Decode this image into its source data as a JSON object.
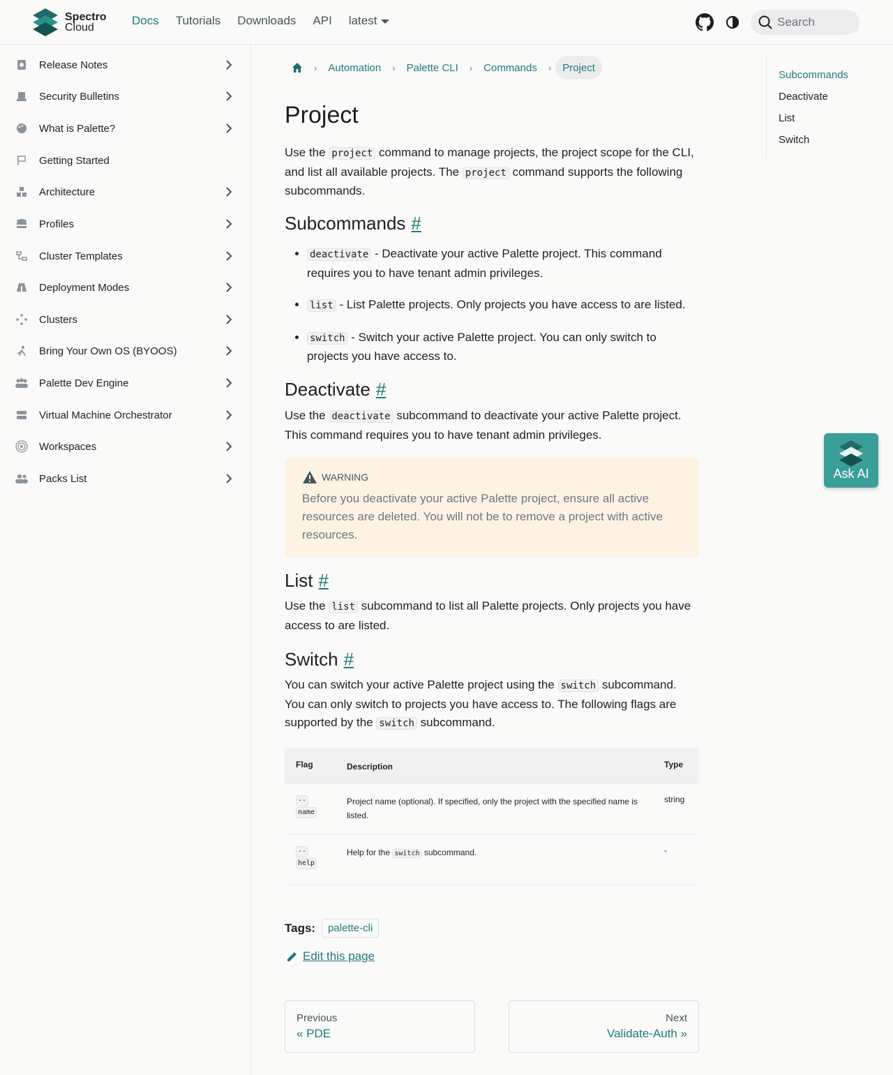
{
  "header": {
    "logo": {
      "line1": "Spectro",
      "line2": "Cloud"
    },
    "nav": [
      {
        "label": "Docs",
        "active": true
      },
      {
        "label": "Tutorials"
      },
      {
        "label": "Downloads"
      },
      {
        "label": "API"
      },
      {
        "label": "latest"
      }
    ],
    "search_placeholder": "Search",
    "icons": [
      "github-icon",
      "theme-toggle-icon",
      "search-icon"
    ]
  },
  "sidebar": {
    "items": [
      {
        "label": "Release Notes",
        "icon": "release-notes-icon",
        "has_children": true
      },
      {
        "label": "Security Bulletins",
        "icon": "security-icon",
        "has_children": true
      },
      {
        "label": "What is Palette?",
        "icon": "palette-icon",
        "has_children": true
      },
      {
        "label": "Getting Started",
        "icon": "flag-icon",
        "has_children": false
      },
      {
        "label": "Architecture",
        "icon": "architecture-icon",
        "has_children": true
      },
      {
        "label": "Profiles",
        "icon": "profiles-icon",
        "has_children": true
      },
      {
        "label": "Cluster Templates",
        "icon": "cluster-templates-icon",
        "has_children": true
      },
      {
        "label": "Deployment Modes",
        "icon": "deployment-icon",
        "has_children": true
      },
      {
        "label": "Clusters",
        "icon": "clusters-icon",
        "has_children": true
      },
      {
        "label": "Bring Your Own OS (BYOOS)",
        "icon": "byoos-icon",
        "has_children": true
      },
      {
        "label": "Palette Dev Engine",
        "icon": "dev-engine-icon",
        "has_children": true
      },
      {
        "label": "Virtual Machine Orchestrator",
        "icon": "server-icon",
        "has_children": true
      },
      {
        "label": "Workspaces",
        "icon": "workspaces-icon",
        "has_children": true
      },
      {
        "label": "Packs List",
        "icon": "packs-icon",
        "has_children": true
      }
    ]
  },
  "breadcrumb": [
    "Automation",
    "Palette CLI",
    "Commands",
    "Project"
  ],
  "page": {
    "title": "Project",
    "intro": {
      "p1": "Use the ",
      "code1": "project",
      "p2": " command to manage projects, the project scope for the CLI, and list all available projects. The ",
      "code2": "project",
      "p3": " command supports the following subcommands."
    },
    "subcommands": {
      "heading": "Subcommands",
      "hash": "#",
      "items": [
        {
          "code": "deactivate",
          "text": " - Deactivate your active Palette project. This command requires you to have tenant admin privileges."
        },
        {
          "code": "list",
          "text": " - List Palette projects. Only projects you have access to are listed."
        },
        {
          "code": "switch",
          "text": " - Switch your active Palette project. You can only switch to projects you have access to."
        }
      ]
    },
    "deactivate": {
      "heading": "Deactivate",
      "hash": "#",
      "p1": "Use the ",
      "code": "deactivate",
      "p2": " subcommand to deactivate your active Palette project. This command requires you to have tenant admin privileges.",
      "warning_title": "WARNING",
      "warning_body": "Before you deactivate your active Palette project, ensure all active resources are deleted. You will not be to remove a project with active resources."
    },
    "list": {
      "heading": "List",
      "hash": "#",
      "p1": "Use the ",
      "code": "list",
      "p2": " subcommand to list all Palette projects. Only projects you have access to are listed."
    },
    "switch": {
      "heading": "Switch",
      "hash": "#",
      "p1": "You can switch your active Palette project using the ",
      "code1": "switch",
      "p2": " subcommand. You can only switch to projects you have access to. The following flags are supported by the ",
      "code2": "switch",
      "p3": " subcommand."
    },
    "table": {
      "headers": [
        "Flag",
        "Description",
        "Type"
      ],
      "rows": [
        {
          "flag_a": "--",
          "flag_b": "name",
          "desc": "Project name (optional). If specified, only the project with the specified name is listed.",
          "type": "string"
        },
        {
          "flag_a": "--",
          "flag_b": "help",
          "desc_a": "Help for the ",
          "desc_code": "switch",
          "desc_b": " subcommand.",
          "type": "-"
        }
      ]
    },
    "tags_label": "Tags:",
    "tags": [
      "palette-cli"
    ],
    "edit_label": "Edit this page",
    "prev": {
      "sub": "Previous",
      "label": "« PDE"
    },
    "next": {
      "sub": "Next",
      "label": "Validate-Auth »"
    }
  },
  "toc": [
    "Subcommands",
    "Deactivate",
    "List",
    "Switch"
  ],
  "ask_ai": "Ask AI",
  "colors": {
    "accent": "#207a7a",
    "warning_bg": "#fef3e2",
    "askai_bg": "#3a9f98"
  }
}
